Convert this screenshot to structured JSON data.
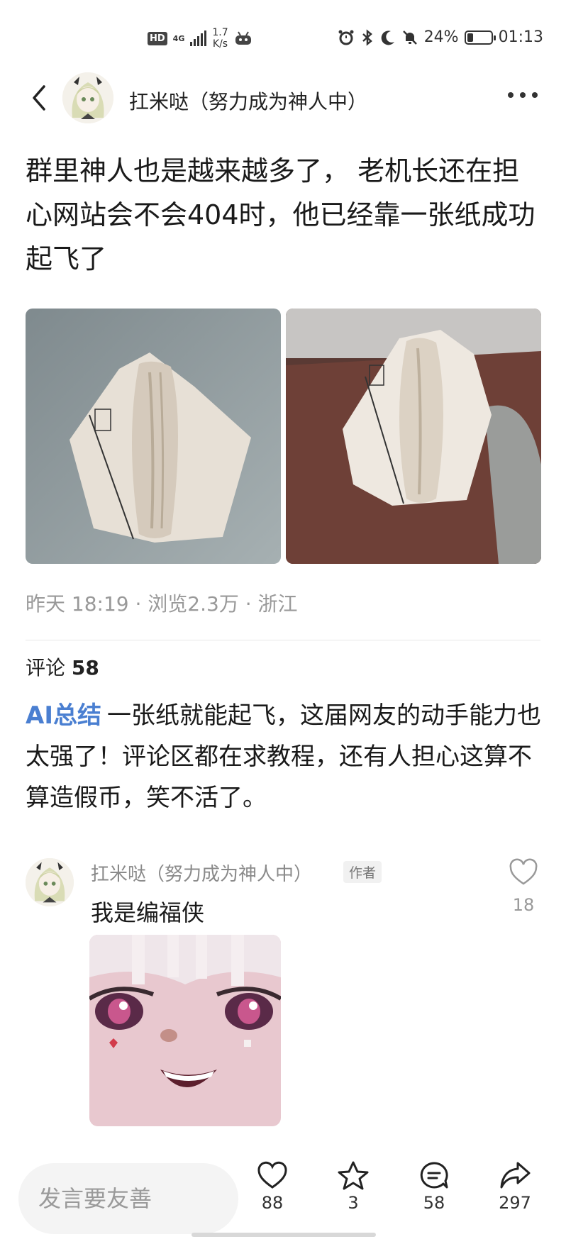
{
  "status_bar": {
    "hd": "HD",
    "network": "4G",
    "speed_value": "1.7",
    "speed_unit": "K/s",
    "battery_percent": "24%",
    "battery_level": 0.24,
    "time": "01:13"
  },
  "header": {
    "author_name": "扛米哒（努力成为神人中）"
  },
  "post": {
    "text": "群里神人也是越来越多了， 老机长还在担心网站会不会404时，他已经靠一张纸成功起飞了",
    "meta": "昨天 18:19 · 浏览2.3万 · 浙江"
  },
  "comments": {
    "label": "评论",
    "count": "58"
  },
  "ai_summary": {
    "tag": "AI总结",
    "text": "一张纸就能起飞，这届网友的动手能力也太强了！评论区都在求教程，还有人担心这算不算造假币，笑不活了。"
  },
  "comment": {
    "author": "扛米哒（努力成为神人中）",
    "badge": "作者",
    "text": "我是编福侠",
    "likes": "18"
  },
  "bottom_bar": {
    "input_placeholder": "发言要友善",
    "like_count": "88",
    "favorite_count": "3",
    "comment_count": "58",
    "share_count": "297"
  }
}
